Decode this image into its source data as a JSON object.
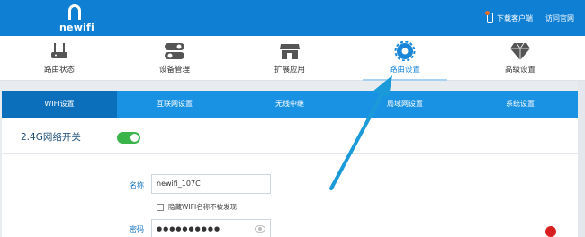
{
  "header": {
    "brand": "newifi",
    "links": [
      {
        "label": "下载客户端",
        "icon": "phone-icon"
      },
      {
        "label": "访问官网"
      }
    ]
  },
  "nav": [
    {
      "label": "路由状态",
      "icon": "router-icon"
    },
    {
      "label": "设备管理",
      "icon": "toggles-icon"
    },
    {
      "label": "扩展应用",
      "icon": "store-icon"
    },
    {
      "label": "路由设置",
      "icon": "gear-icon",
      "active": true
    },
    {
      "label": "高级设置",
      "icon": "diamond-icon"
    }
  ],
  "subtabs": [
    {
      "label": "WIFI设置",
      "active": true
    },
    {
      "label": "互联网设置"
    },
    {
      "label": "无线中继"
    },
    {
      "label": "局域网设置"
    },
    {
      "label": "系统设置"
    }
  ],
  "wifi": {
    "section_title": "2.4G网络开关",
    "toggle_on": true,
    "name_label": "名称",
    "name_value": "newifi_107C",
    "hide_label": "隐藏WIFI名称不被发现",
    "hide_checked": false,
    "password_label": "密码",
    "password_value": "●●●●●●●●●●"
  },
  "colors": {
    "header": "#0e7fd3",
    "subtabs": "#1a92e3",
    "active_tab": "#0b6fbb",
    "toggle": "#3bb44a",
    "arrow": "#1a9ad8"
  }
}
